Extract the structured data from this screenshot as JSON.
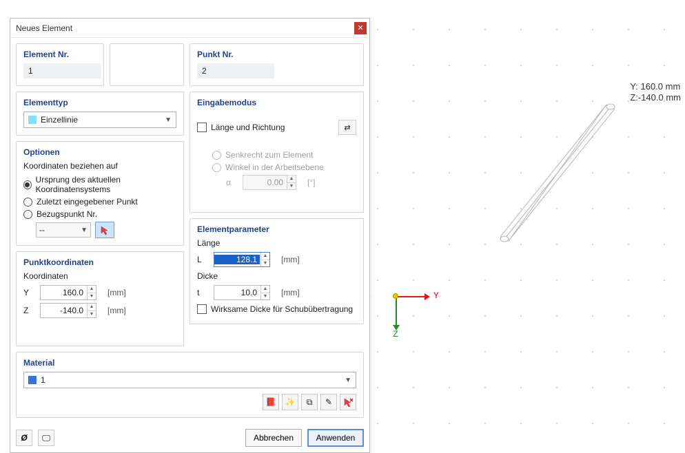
{
  "dialog": {
    "title": "Neues Element",
    "element_nr": {
      "label": "Element Nr.",
      "value": "1"
    },
    "punkt_nr": {
      "label": "Punkt Nr.",
      "value": "2"
    },
    "elementtyp": {
      "label": "Elementtyp",
      "value": "Einzellinie"
    },
    "eingabemodus": {
      "label": "Eingabemodus",
      "checkbox_label": "Länge und Richtung",
      "radio_senkrecht": "Senkrecht zum Element",
      "radio_winkel": "Winkel in der Arbeitsebene",
      "alpha_label": "α",
      "alpha_value": "0.00",
      "alpha_unit": "[°]"
    },
    "optionen": {
      "label": "Optionen",
      "sub_label": "Koordinaten beziehen auf",
      "opt_ursprung": "Ursprung des aktuellen Koordinatensystems",
      "opt_zuletzt": "Zuletzt eingegebener Punkt",
      "opt_bezug": "Bezugspunkt Nr.",
      "bezug_value": "--"
    },
    "punktkoord": {
      "label": "Punktkoordinaten",
      "sub_label": "Koordinaten",
      "y_label": "Y",
      "y_value": "160.0",
      "y_unit": "[mm]",
      "z_label": "Z",
      "z_value": "-140.0",
      "z_unit": "[mm]"
    },
    "elementparam": {
      "label": "Elementparameter",
      "laenge_label": "Länge",
      "l_label": "L",
      "l_value": "128.1",
      "l_unit": "[mm]",
      "dicke_label": "Dicke",
      "t_label": "t",
      "t_value": "10.0",
      "t_unit": "[mm]",
      "wirksame_label": "Wirksame Dicke für Schubübertragung"
    },
    "material": {
      "label": "Material",
      "value": "1"
    },
    "buttons": {
      "cancel": "Abbrechen",
      "apply": "Anwenden"
    }
  },
  "viewport": {
    "readout_y": "Y: 160.0  mm",
    "readout_z": "Z:-140.0  mm",
    "axis_y": "Y",
    "axis_z": "Z"
  }
}
